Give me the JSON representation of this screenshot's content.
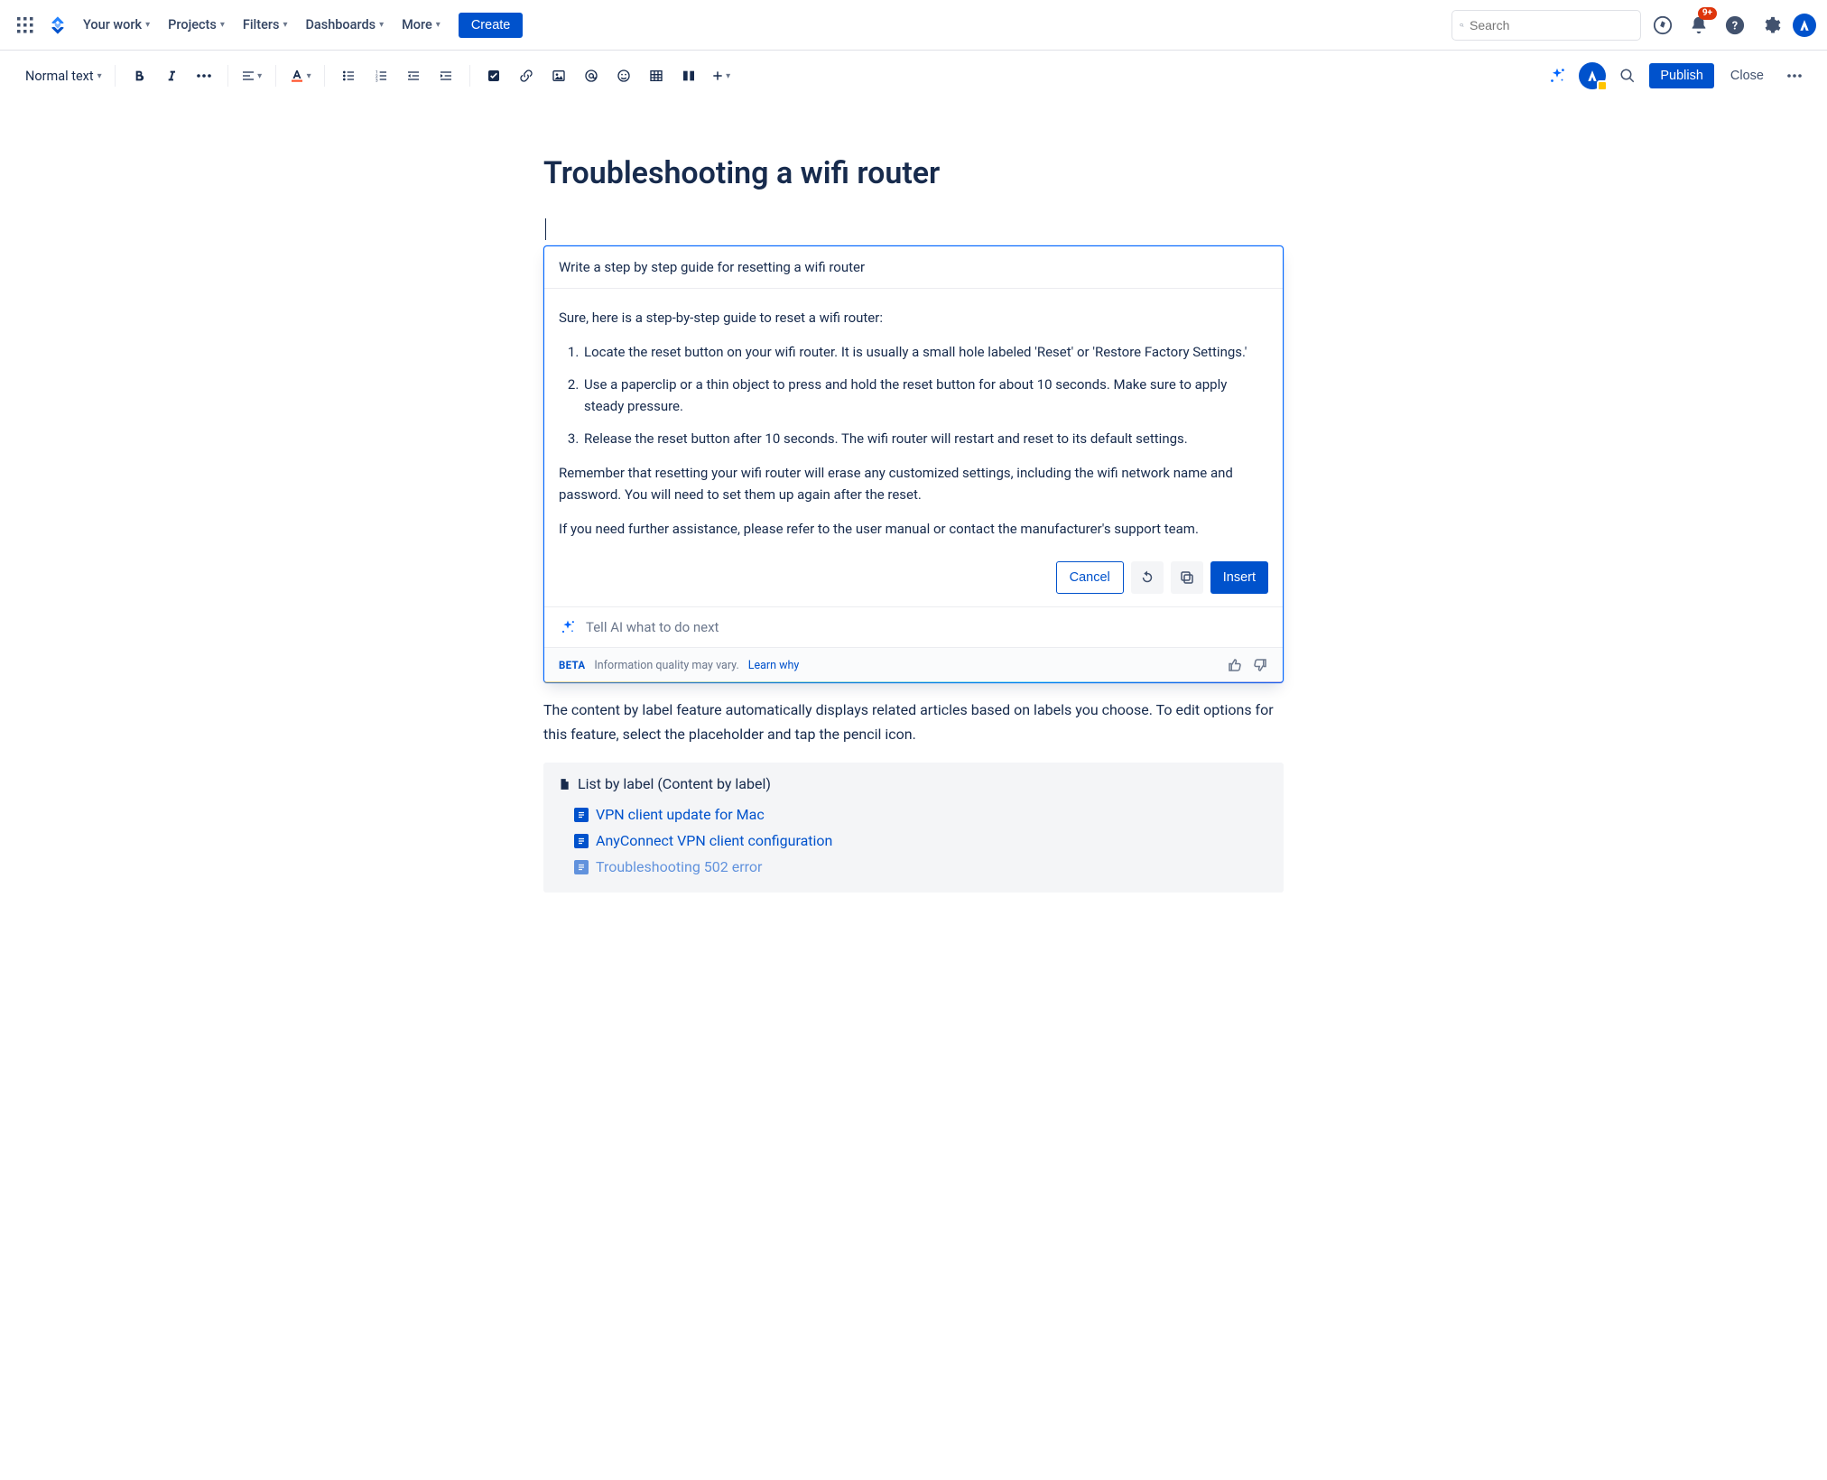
{
  "topnav": {
    "links": [
      "Your work",
      "Projects",
      "Filters",
      "Dashboards",
      "More"
    ],
    "create": "Create",
    "search_placeholder": "Search",
    "notif_badge": "9+"
  },
  "toolbar": {
    "text_style": "Normal text",
    "publish": "Publish",
    "close": "Close"
  },
  "doc": {
    "title": "Troubleshooting a wifi router"
  },
  "ai": {
    "prompt": "Write a step by step guide for resetting a wifi router",
    "intro": "Sure, here is a step-by-step guide to reset a wifi router:",
    "steps": [
      "Locate the reset button on your wifi router. It is usually a small hole labeled 'Reset' or 'Restore Factory Settings.'",
      "Use a paperclip or a thin object to press and hold the reset button for about 10 seconds. Make sure to apply steady pressure.",
      "Release the reset button after 10 seconds. The wifi router will restart and reset to its default settings."
    ],
    "note1": "Remember that resetting your wifi router will erase any customized settings, including the wifi network name and password. You will need to set them up again after the reset.",
    "note2": "If you need further assistance, please refer to the user manual or contact the manufacturer's support team.",
    "cancel": "Cancel",
    "insert": "Insert",
    "next_placeholder": "Tell AI what to do next",
    "beta": "BETA",
    "disclaimer": "Information quality may vary.",
    "learn": "Learn why"
  },
  "body_para": "The content by label feature automatically displays related articles based on labels you choose. To edit options for this feature, select the placeholder and tap the pencil icon.",
  "cbl": {
    "title": "List by label (Content by label)",
    "items": [
      "VPN client update for Mac",
      "AnyConnect VPN client configuration",
      "Troubleshooting 502 error"
    ]
  }
}
